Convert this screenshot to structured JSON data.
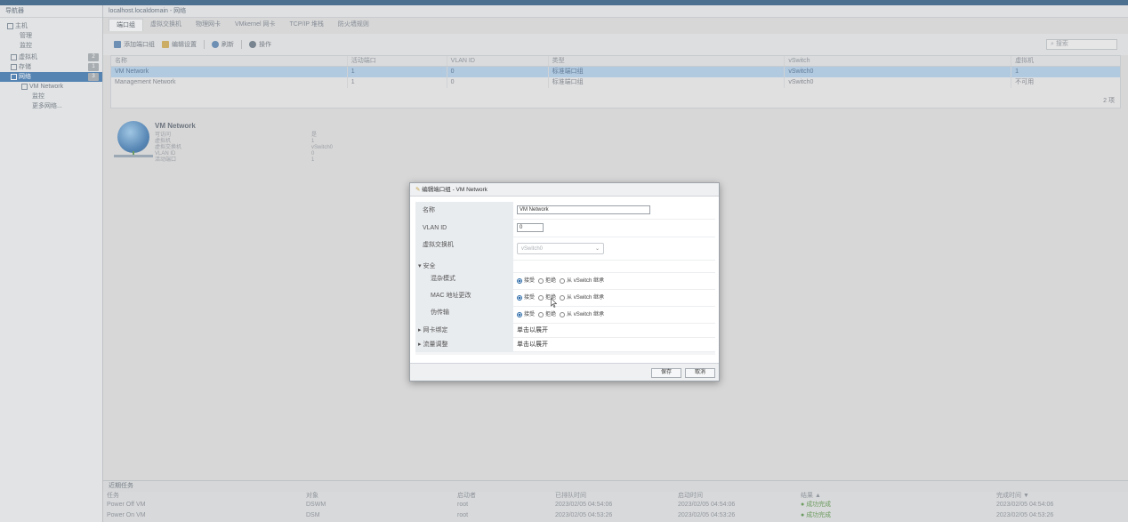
{
  "nav": {
    "title": "导航器",
    "items": [
      {
        "label": "主机",
        "badge": ""
      },
      {
        "label": "管理",
        "badge": ""
      },
      {
        "label": "监控",
        "badge": ""
      },
      {
        "label": "虚拟机",
        "badge": "2"
      },
      {
        "label": "存储",
        "badge": "1"
      },
      {
        "label": "网络",
        "badge": "3"
      },
      {
        "label": "VM Network",
        "badge": ""
      },
      {
        "label": "监控",
        "badge": ""
      },
      {
        "label": "更多网络...",
        "badge": ""
      }
    ]
  },
  "main": {
    "title": "localhost.localdomain - 网络",
    "tabs": [
      "端口组",
      "虚拟交换机",
      "物理网卡",
      "VMkernel 网卡",
      "TCP/IP 堆栈",
      "防火墙规则"
    ],
    "toolbar": {
      "add": "添加端口组",
      "edit": "编辑设置",
      "refresh": "刷新",
      "actions": "操作",
      "search_placeholder": "搜索"
    },
    "columns": [
      "名称",
      "活动端口",
      "VLAN ID",
      "类型",
      "vSwitch",
      "虚拟机"
    ],
    "rows": [
      {
        "name": "VM Network",
        "ports": "1",
        "vlan": "0",
        "type": "标准端口组",
        "vswitch": "vSwitch0",
        "vms": "1"
      },
      {
        "name": "Management Network",
        "ports": "1",
        "vlan": "0",
        "type": "标准端口组",
        "vswitch": "vSwitch0",
        "vms": "不可用"
      }
    ],
    "grid_count": "2 项",
    "detail": {
      "name": "VM Network",
      "rows": [
        {
          "k": "可访问",
          "v": "是"
        },
        {
          "k": "虚拟机",
          "v": "1"
        },
        {
          "k": "虚拟交换机",
          "v": "vSwitch0"
        },
        {
          "k": "VLAN ID",
          "v": "0"
        },
        {
          "k": "活动端口",
          "v": "1"
        }
      ]
    }
  },
  "tasks": {
    "title": "近期任务",
    "columns": [
      "任务",
      "对象",
      "启动者",
      "已排队时间",
      "启动时间",
      "结果 ▲",
      "完成时间 ▼"
    ],
    "rows": [
      {
        "task": "Power Off VM",
        "target": "DSWM",
        "initiator": "root",
        "queued": "2023/02/05 04:54:06",
        "started": "2023/02/05 04:54:06",
        "result": "成功完成",
        "completed": "2023/02/05 04:54:06"
      },
      {
        "task": "Power On VM",
        "target": "DSM",
        "initiator": "root",
        "queued": "2023/02/05 04:53:26",
        "started": "2023/02/05 04:53:26",
        "result": "成功完成",
        "completed": "2023/02/05 04:53:26"
      }
    ]
  },
  "dialog": {
    "title": "编辑端口组 - VM Network",
    "name_label": "名称",
    "name_value": "VM Network",
    "vlan_label": "VLAN ID",
    "vlan_value": "0",
    "vswitch_label": "虚拟交换机",
    "vswitch_value": "vSwitch0",
    "security_label": "安全",
    "promisc_label": "混杂模式",
    "mac_label": "MAC 地址更改",
    "forged_label": "伪传输",
    "opt_accept": "接受",
    "opt_reject": "拒绝",
    "opt_inherit": "从 vSwitch 继承",
    "nic_label": "网卡绑定",
    "nic_value": "单击以展开",
    "shaping_label": "流量调整",
    "shaping_value": "单击以展开",
    "save": "保存",
    "cancel": "取消"
  },
  "colors": {
    "accent": "#2b6aa8",
    "selection": "#a6c7e5",
    "success": "#4a8a3a"
  }
}
